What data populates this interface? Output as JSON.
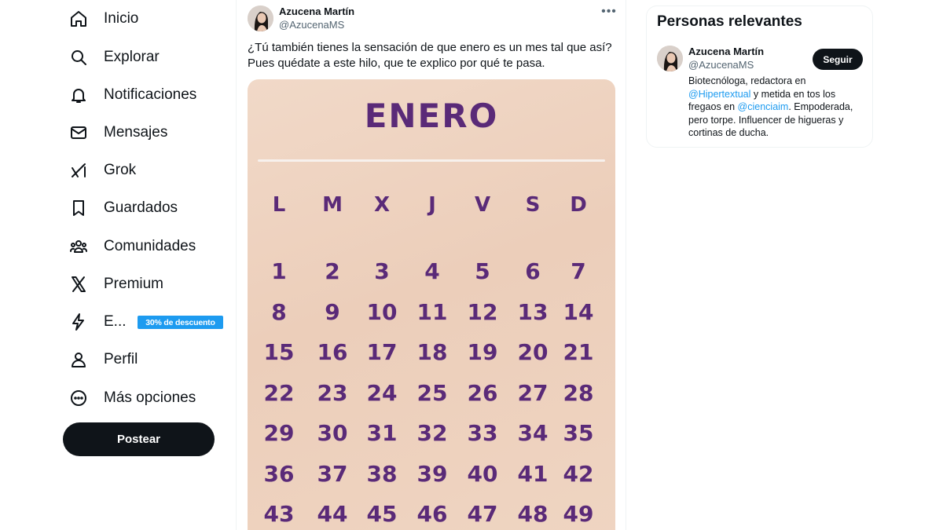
{
  "sidebar": {
    "items": [
      {
        "label": "Inicio",
        "icon": "home-icon"
      },
      {
        "label": "Explorar",
        "icon": "search-icon"
      },
      {
        "label": "Notificaciones",
        "icon": "bell-icon"
      },
      {
        "label": "Mensajes",
        "icon": "mail-icon"
      },
      {
        "label": "Grok",
        "icon": "grok-icon"
      },
      {
        "label": "Guardados",
        "icon": "bookmark-icon"
      },
      {
        "label": "Comunidades",
        "icon": "communities-icon"
      },
      {
        "label": "Premium",
        "icon": "x-logo-icon"
      },
      {
        "label": "E...",
        "icon": "lightning-icon"
      },
      {
        "label": "Perfil",
        "icon": "person-icon"
      },
      {
        "label": "Más opciones",
        "icon": "more-circle-icon"
      }
    ],
    "promo_badge": "30% de descuento",
    "post_button": "Postear"
  },
  "tweet": {
    "author_name": "Azucena Martín",
    "author_handle": "@AzucenaMS",
    "more_icon": "more-horizontal-icon",
    "text_line1": "¿Tú también tienes la sensación de que enero es un mes tal que así?",
    "text_line2": "Pues quédate a este hilo, que te explico por qué te pasa.",
    "media": {
      "calendar_title": "ENERO",
      "weekdays": [
        "L",
        "M",
        "X",
        "J",
        "V",
        "S",
        "D"
      ],
      "weeks": [
        [
          "1",
          "2",
          "3",
          "4",
          "5",
          "6",
          "7"
        ],
        [
          "8",
          "9",
          "10",
          "11",
          "12",
          "13",
          "14"
        ],
        [
          "15",
          "16",
          "17",
          "18",
          "19",
          "20",
          "21"
        ],
        [
          "22",
          "23",
          "24",
          "25",
          "26",
          "27",
          "28"
        ],
        [
          "29",
          "30",
          "31",
          "32",
          "33",
          "34",
          "35"
        ],
        [
          "36",
          "37",
          "38",
          "39",
          "40",
          "41",
          "42"
        ],
        [
          "43",
          "44",
          "45",
          "46",
          "47",
          "48",
          "49"
        ]
      ],
      "text_color": "#5a2a78",
      "background_color": "#f0d4c2"
    }
  },
  "right_panel": {
    "title": "Personas relevantes",
    "person": {
      "name": "Azucena Martín",
      "handle": "@AzucenaMS",
      "follow_label": "Seguir",
      "bio_l1": "Biotecnóloga, redactora en",
      "bio_mention1": "@Hipertextual",
      "bio_l2_rest": " y metida en tos los",
      "bio_l3_start": "fregaos en ",
      "bio_mention2": "@cienciaim",
      "bio_l3_rest": ". Empoderada,",
      "bio_l4": "pero torpe. Influencer de higueras y",
      "bio_l5": "cortinas de ducha."
    }
  },
  "colors": {
    "accent": "#1d9bf0",
    "text_primary": "#0f1419",
    "text_secondary": "#536471",
    "button_dark": "#0f1419"
  }
}
